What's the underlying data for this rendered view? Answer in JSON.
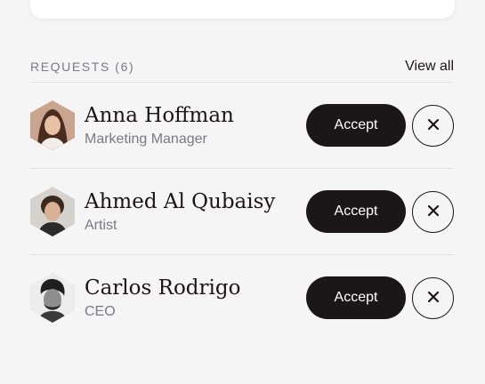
{
  "section": {
    "title": "REQUESTS (6)",
    "view_all": "View all"
  },
  "requests": [
    {
      "name": "Anna Hoffman",
      "role": "Marketing Manager",
      "accept_label": "Accept",
      "decline_icon": "close-icon"
    },
    {
      "name": "Ahmed Al Qubaisy",
      "role": "Artist",
      "accept_label": "Accept",
      "decline_icon": "close-icon"
    },
    {
      "name": "Carlos Rodrigo",
      "role": "CEO",
      "accept_label": "Accept",
      "decline_icon": "close-icon"
    }
  ],
  "colors": {
    "background": "#f5f5f6",
    "accent_button": "#1b1618",
    "muted_text": "#7a7a80",
    "divider": "#e2e2e5"
  }
}
